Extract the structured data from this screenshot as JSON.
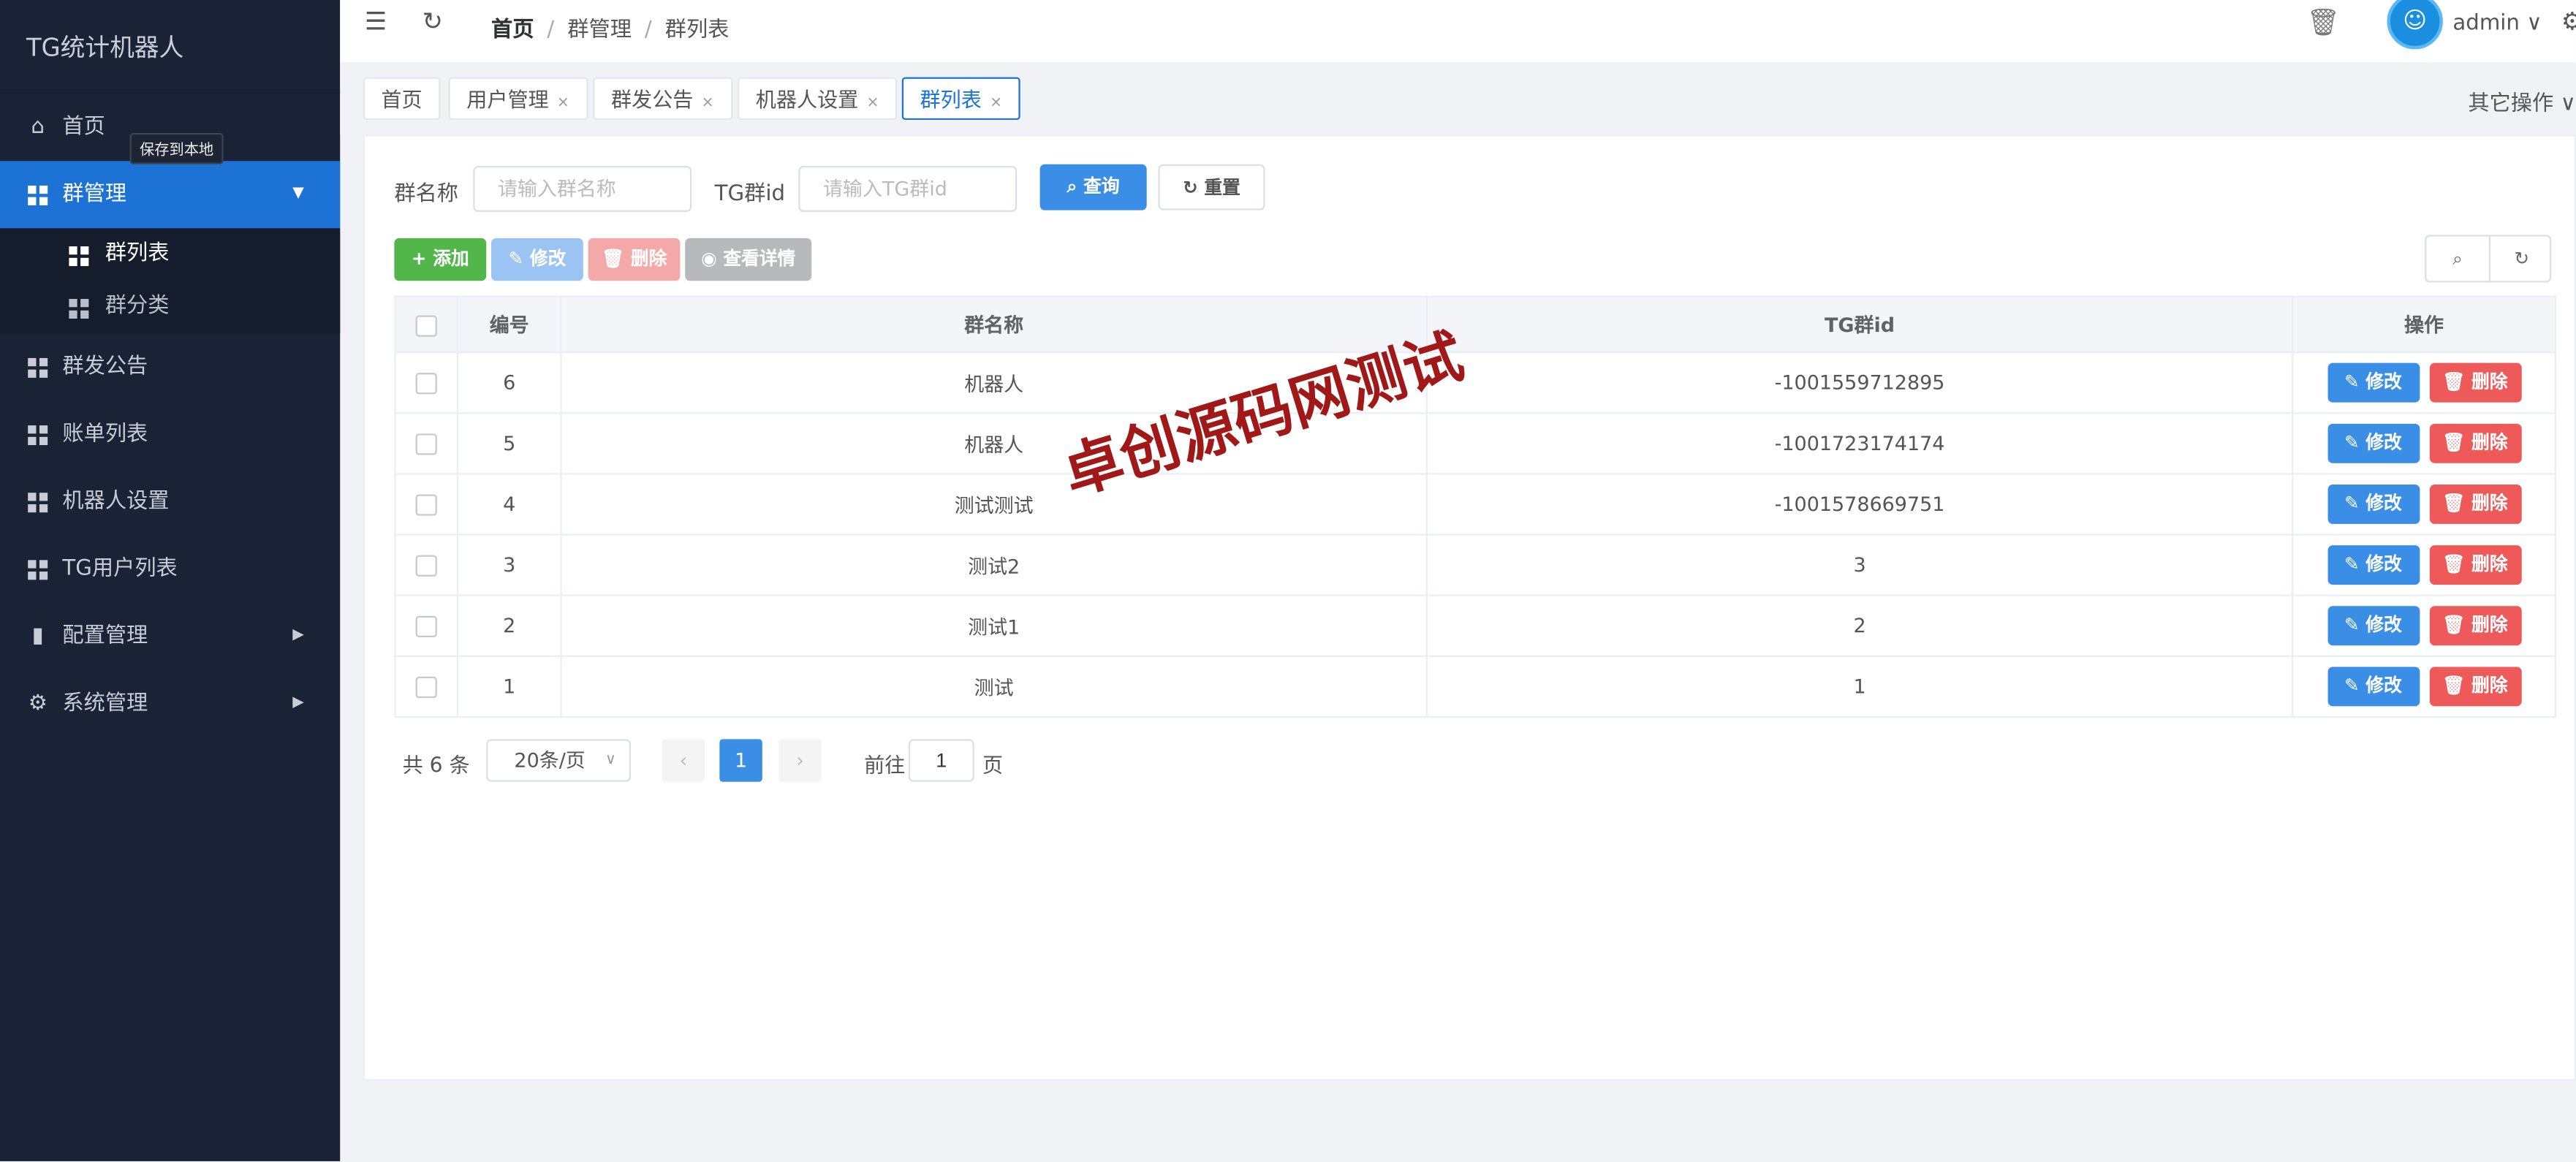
{
  "app": {
    "title": "TG统计机器人"
  },
  "sidebar": {
    "tooltip": "保存到本地",
    "items": [
      {
        "label": "首页",
        "icon": "home-icon"
      },
      {
        "label": "群管理",
        "icon": "grid-icon",
        "active": true,
        "expanded": true,
        "children": [
          {
            "label": "群列表",
            "active": true
          },
          {
            "label": "群分类"
          }
        ]
      },
      {
        "label": "群发公告",
        "icon": "grid-icon"
      },
      {
        "label": "账单列表",
        "icon": "grid-icon"
      },
      {
        "label": "机器人设置",
        "icon": "grid-icon"
      },
      {
        "label": "TG用户列表",
        "icon": "grid-icon"
      },
      {
        "label": "配置管理",
        "icon": "bar-chart-icon"
      },
      {
        "label": "系统管理",
        "icon": "gear-icon"
      }
    ]
  },
  "header": {
    "breadcrumb": [
      "首页",
      "群管理",
      "群列表"
    ],
    "user": "admin"
  },
  "tags": {
    "items": [
      {
        "label": "首页",
        "closable": false
      },
      {
        "label": "用户管理",
        "closable": true
      },
      {
        "label": "群发公告",
        "closable": true
      },
      {
        "label": "机器人设置",
        "closable": true
      },
      {
        "label": "群列表",
        "closable": true,
        "active": true
      }
    ],
    "close_glyph": "×",
    "other_ops": "其它操作"
  },
  "search": {
    "name_label": "群名称",
    "name_placeholder": "请输入群名称",
    "tgid_label": "TG群id",
    "tgid_placeholder": "请输入TG群id",
    "query_label": "查询",
    "reset_label": "重置"
  },
  "toolbar": {
    "add_label": "添加",
    "edit_label": "修改",
    "delete_label": "删除",
    "detail_label": "查看详情"
  },
  "table": {
    "headers": {
      "id": "编号",
      "name": "群名称",
      "tgid": "TG群id",
      "ops": "操作"
    },
    "rows": [
      {
        "id": "6",
        "name": "机器人",
        "tgid": "-1001559712895"
      },
      {
        "id": "5",
        "name": "机器人",
        "tgid": "-1001723174174"
      },
      {
        "id": "4",
        "name": "测试测试",
        "tgid": "-1001578669751"
      },
      {
        "id": "3",
        "name": "测试2",
        "tgid": "3"
      },
      {
        "id": "2",
        "name": "测试1",
        "tgid": "2"
      },
      {
        "id": "1",
        "name": "测试",
        "tgid": "1"
      }
    ],
    "row_edit_label": "修改",
    "row_delete_label": "删除"
  },
  "pagination": {
    "total": "共 6 条",
    "page_size": "20条/页",
    "current_page": "1",
    "goto_label": "前往",
    "goto_value": "1",
    "page_suffix": "页"
  },
  "watermark": "卓创源码网测试",
  "colors": {
    "primary": "#3a8ee6",
    "success": "#52b64a",
    "danger": "#ee5a5a",
    "sidebar_bg": "#1a2236"
  }
}
